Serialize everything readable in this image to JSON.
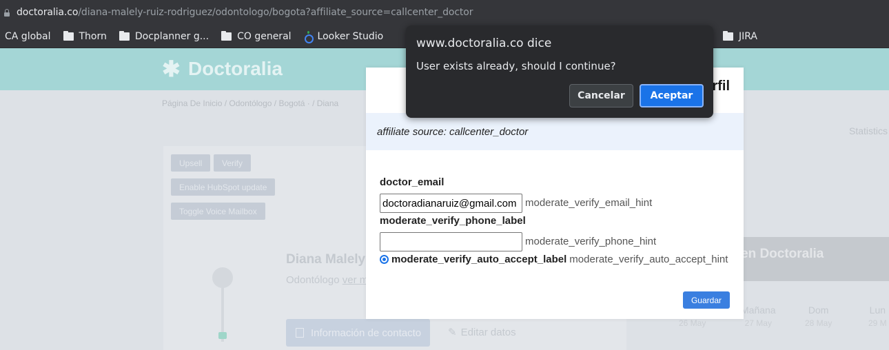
{
  "browser": {
    "url_host": "doctoralia.co",
    "url_path": "/diana-malely-ruiz-rodriguez/odontologo/bogota?affiliate_source=callcenter_doctor",
    "bookmarks": [
      {
        "label": "CA global",
        "icon": "folder-icon"
      },
      {
        "label": "Thorn",
        "icon": "folder-icon"
      },
      {
        "label": "Docplanner g...",
        "icon": "folder-icon"
      },
      {
        "label": "CO general",
        "icon": "folder-icon"
      },
      {
        "label": "Looker Studio",
        "icon": "looker-studio-icon"
      },
      {
        "label": "JIRA",
        "icon": "folder-icon"
      }
    ]
  },
  "site": {
    "logo_text": "Doctoralia",
    "breadcrumb": "Página De Inicio / Odontólogo / Bogotá · / Diana",
    "statistics_tab": "Statistics",
    "buttons": {
      "upsell": "Upsell",
      "verify": "Verify",
      "enable_hubspot": "Enable HubSpot update",
      "toggle_voice": "Toggle Voice Mailbox"
    },
    "profile_name": "Diana Malely",
    "profile_specialty": "Odontólogo",
    "profile_link": "ver m",
    "contact_button": "Información de contacto",
    "edit_data": "Editar datos",
    "right_card_title": "en Doctoralia",
    "calendar_days": [
      {
        "label": "",
        "date": "26 May"
      },
      {
        "label": "Mañana",
        "date": "27 May"
      },
      {
        "label": "Dom",
        "date": "28 May"
      },
      {
        "label": "Lun",
        "date": "29 M"
      }
    ]
  },
  "modal": {
    "title_fragment": "rfil",
    "affiliate_text": "affiliate source: callcenter_doctor",
    "email_label": "doctor_email",
    "email_value": "doctoradianaruiz@gmail.com",
    "email_hint": "moderate_verify_email_hint",
    "phone_label": "moderate_verify_phone_label",
    "phone_value": "",
    "phone_hint": "moderate_verify_phone_hint",
    "auto_accept_label": "moderate_verify_auto_accept_label",
    "auto_accept_hint": "moderate_verify_auto_accept_hint",
    "auto_accept_checked": true,
    "save_button": "Guardar"
  },
  "alert": {
    "title": "www.doctoralia.co dice",
    "message": "User exists already, should I continue?",
    "cancel": "Cancelar",
    "accept": "Aceptar"
  },
  "colors": {
    "accent": "#1a73e8",
    "site_header": "#a4d6d6",
    "save_button": "#3a7fe0"
  }
}
